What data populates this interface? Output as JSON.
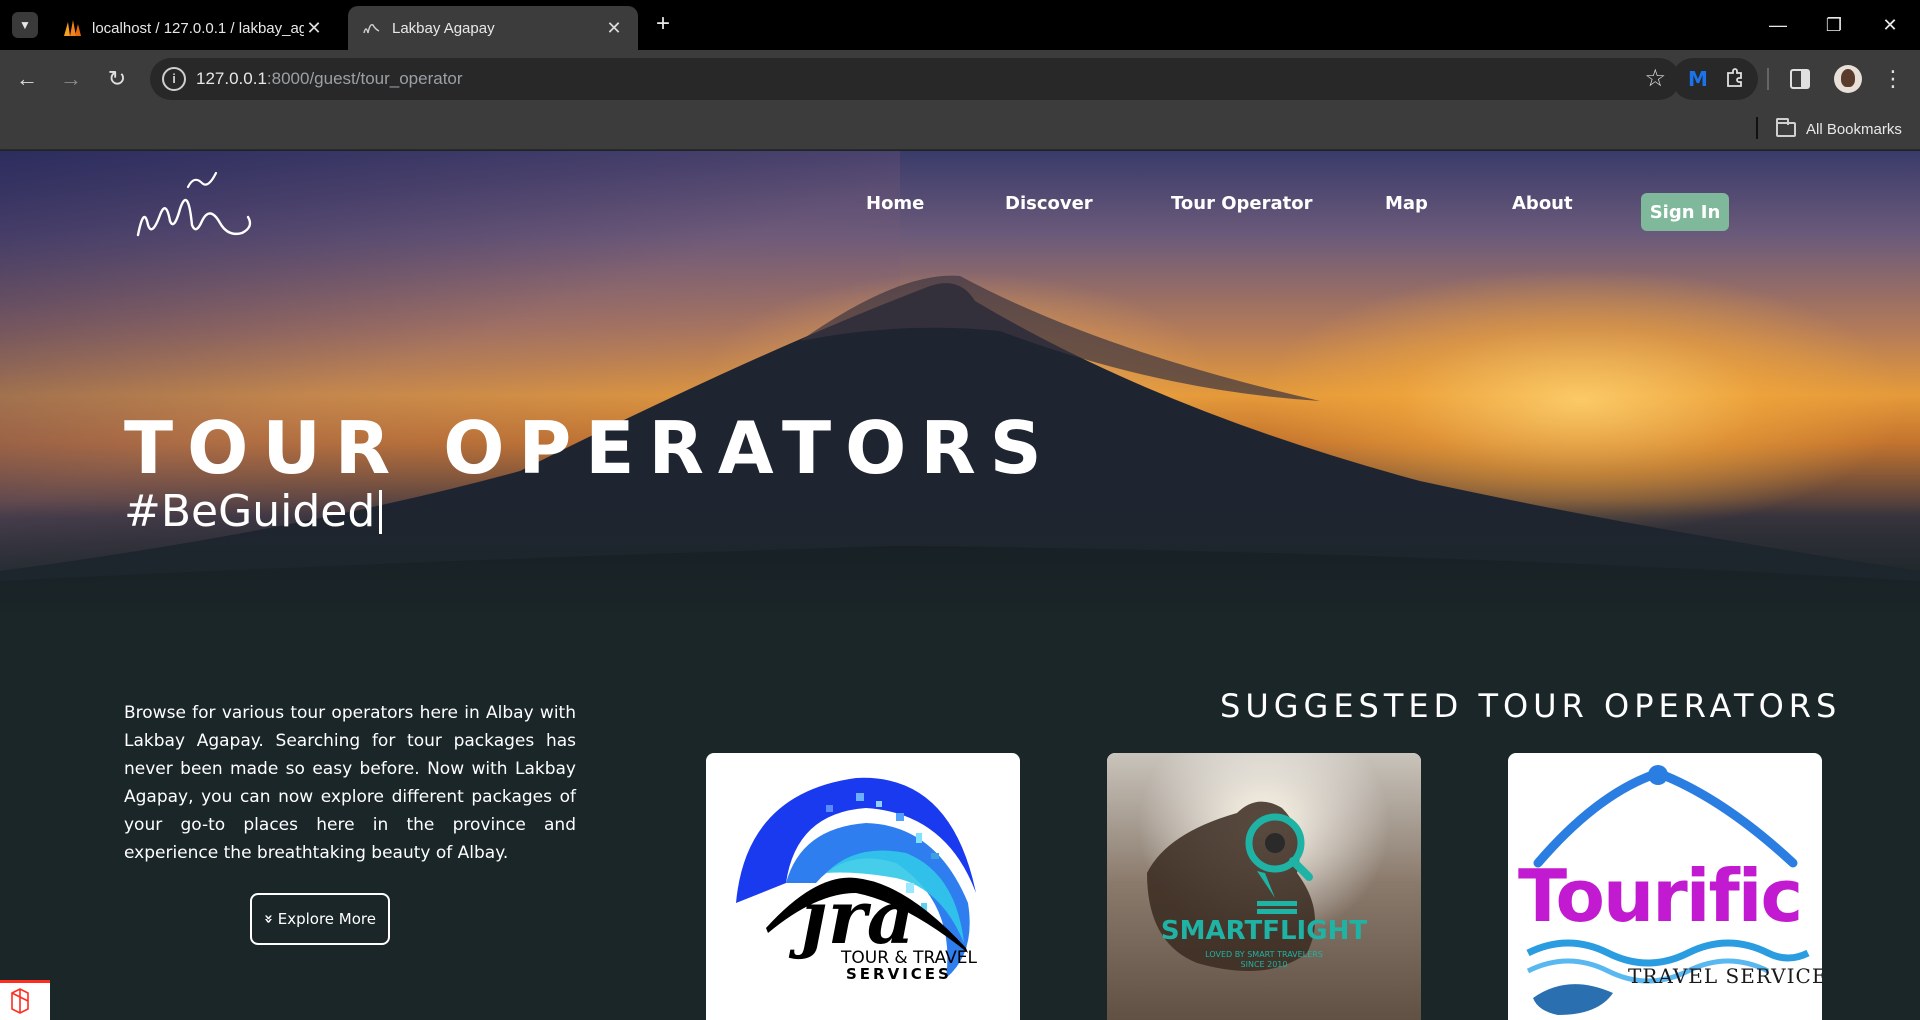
{
  "browser": {
    "tabs": [
      {
        "title": "localhost / 127.0.0.1 / lakbay_ag",
        "active": false
      },
      {
        "title": "Lakbay Agapay",
        "active": true
      }
    ],
    "new_tab": "+",
    "close_glyph": "✕",
    "address": {
      "host": "127.0.0.1",
      "rest": ":8000/guest/tour_operator"
    },
    "bookmarks_label": "All Bookmarks",
    "window_controls": {
      "minimize": "—",
      "restore": "❐",
      "close": "✕"
    }
  },
  "site": {
    "nav": [
      {
        "label": "Home"
      },
      {
        "label": "Discover"
      },
      {
        "label": "Tour Operator"
      },
      {
        "label": "Map"
      },
      {
        "label": "About"
      }
    ],
    "signin_label": "Sign In",
    "hero": {
      "title": "TOUR OPERATORS",
      "subtitle": "#BeGuided"
    },
    "intro": "Browse for various tour operators here in Albay with Lakbay Agapay. Searching for tour packages has never been made so easy before. Now with Lakbay Agapay, you can now explore different packages of your go-to places here in the province and experience the breathtaking beauty of Albay.",
    "explore_label": "Explore More",
    "explore_glyph": "»",
    "suggested_title": "SUGGESTED TOUR OPERATORS",
    "operators": [
      {
        "logo_line1": "jra",
        "logo_line2": "TOUR & TRAVEL",
        "logo_line3": "SERVICES"
      },
      {
        "logo_line1": "SMARTFLIGHT",
        "logo_line2": "LOVED BY SMART TRAVELERS",
        "logo_line3": "SINCE 2010"
      },
      {
        "logo_line1": "Tourific",
        "logo_line2": "TRAVEL SERVICES"
      }
    ]
  },
  "colors": {
    "page_bg": "#1b2629",
    "signin_bg": "#7fb89a",
    "chrome_bg": "#3c3c3c"
  },
  "icons": [
    "tab-search-icon",
    "back-arrow-icon",
    "forward-arrow-icon",
    "reload-icon",
    "site-info-icon",
    "bookmark-star-icon",
    "extension-icon",
    "side-panel-icon",
    "profile-avatar",
    "menu-kebab-icon",
    "folder-icon",
    "laravel-icon"
  ]
}
